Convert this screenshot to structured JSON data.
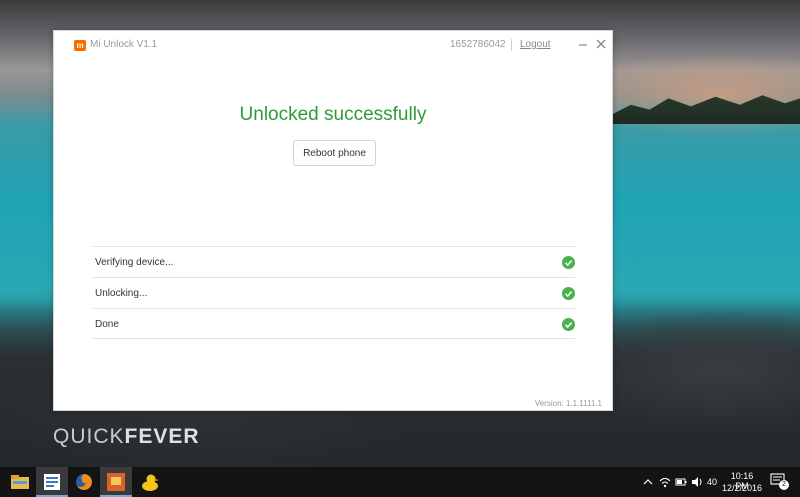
{
  "window": {
    "app_title": "Mi Unlock V1.1",
    "account_id": "1652786042",
    "logout_label": "Logout",
    "status_title": "Unlocked successfully",
    "reboot_label": "Reboot phone",
    "version_text": "Version: 1.1.1111.1",
    "steps": [
      {
        "label": "Verifying device...",
        "status": "done"
      },
      {
        "label": "Unlocking...",
        "status": "done"
      },
      {
        "label": "Done",
        "status": "done"
      }
    ],
    "accent_color": "#2e9d39",
    "brand_color": "#ff6700"
  },
  "desktop": {
    "watermark_light": "QUICK",
    "watermark_bold": "FEVER"
  },
  "taskbar": {
    "apps": [
      "file-explorer-icon",
      "notes-app-icon",
      "firefox-icon",
      "media-app-icon",
      "duck-app-icon"
    ],
    "tray_number": "40",
    "time": "10:16 PM",
    "date": "12/2/2016",
    "notification_count": "2"
  }
}
